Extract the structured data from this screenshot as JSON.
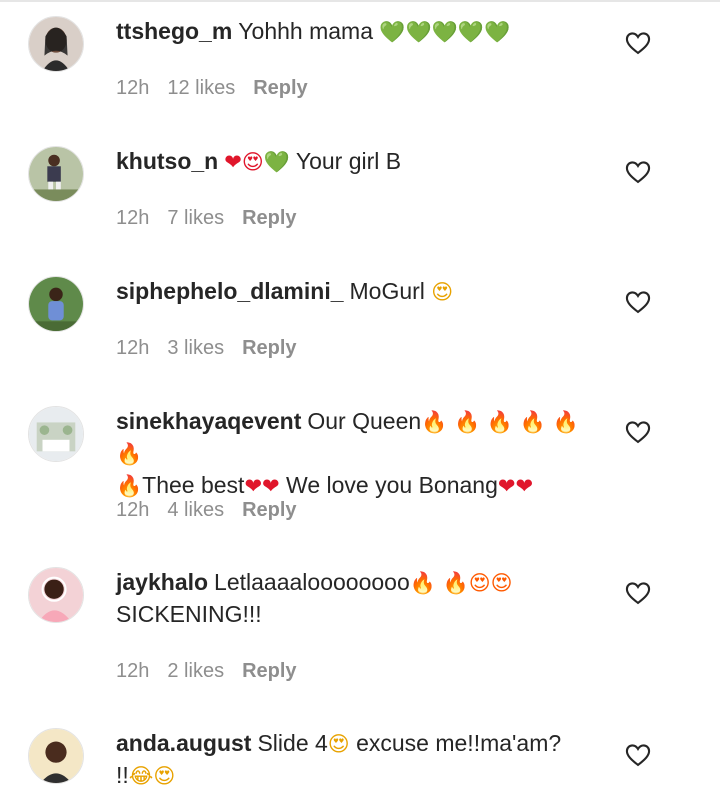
{
  "comments": [
    {
      "username": "ttshego_m",
      "lines": [
        [
          "Yohhh mama ",
          "💚💚💚💚💚"
        ]
      ],
      "time": "12h",
      "likes": "12 likes",
      "reply": "Reply"
    },
    {
      "username": "khutso_n",
      "lines": [
        [
          "",
          "❤😍💚",
          " Your girl B"
        ]
      ],
      "time": "12h",
      "likes": "7 likes",
      "reply": "Reply"
    },
    {
      "username": "siphephelo_dlamini_",
      "lines": [
        [
          "MoGurl ",
          "😍"
        ]
      ],
      "time": "12h",
      "likes": "3 likes",
      "reply": "Reply"
    },
    {
      "username": "sinekhayaqevent",
      "lines": [
        [
          "Our Queen",
          "🔥 🔥 🔥 🔥 🔥 🔥"
        ],
        [
          "",
          "🔥",
          "Thee best",
          "❤❤",
          " We love you Bonang",
          "❤❤"
        ]
      ],
      "time": "12h",
      "likes": "4 likes",
      "reply": "Reply"
    },
    {
      "username": "jaykhalo",
      "lines": [
        [
          "Letlaaaaloooooooo",
          "🔥 🔥😍😍"
        ],
        [
          "SICKENING!!!"
        ]
      ],
      "time": "12h",
      "likes": "2 likes",
      "reply": "Reply"
    },
    {
      "username": "anda.august",
      "lines": [
        [
          "Slide 4",
          "😍",
          " excuse me!!ma'am?"
        ],
        [
          "!!",
          "😂😍"
        ]
      ],
      "time": "",
      "likes": "",
      "reply": ""
    }
  ],
  "colors": {
    "text": "#262626",
    "meta": "#8e8e8e",
    "divider": "#e6e6e6"
  },
  "icons": {
    "like": "heart-outline-icon"
  }
}
